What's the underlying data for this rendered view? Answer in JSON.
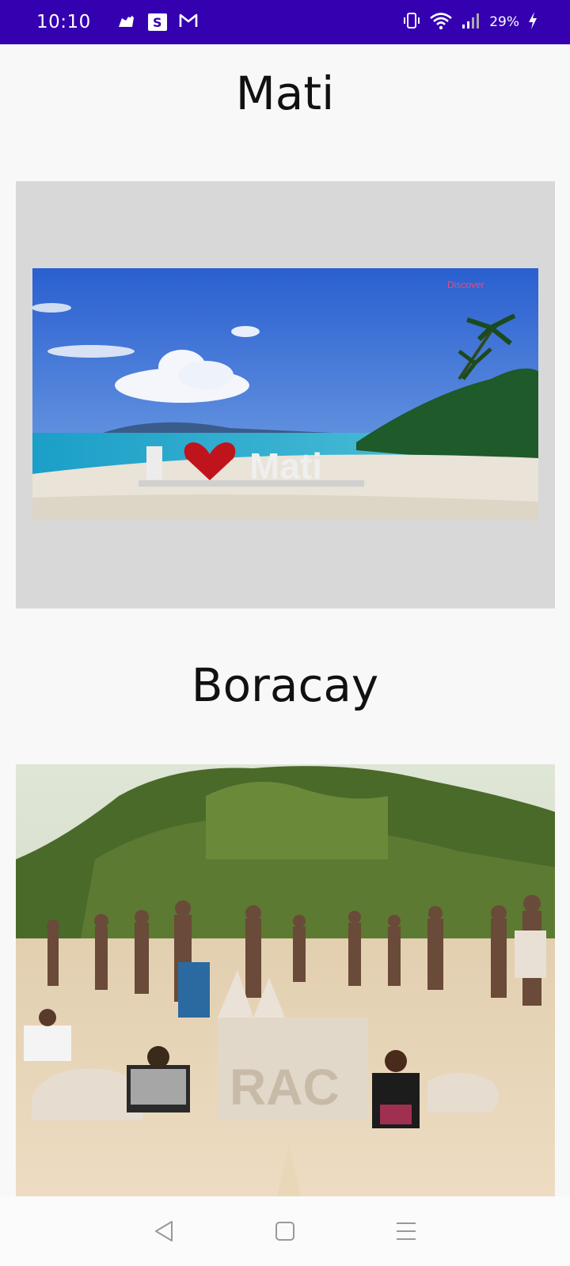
{
  "status_bar": {
    "time": "10:10",
    "battery": "29%",
    "left_icons": [
      "paw-icon",
      "s-app-icon",
      "gmail-icon"
    ],
    "right_icons": [
      "vibrate-icon",
      "wifi-icon",
      "signal-icon",
      "battery-charging-icon"
    ],
    "s_badge": "S",
    "background": "#3500b0"
  },
  "sections": [
    {
      "title": "Mati",
      "image": {
        "description_icon": "beach-photo",
        "sign_text": "I ♥ Mati",
        "watermark": "Discover"
      }
    },
    {
      "title": "Boracay",
      "image": {
        "description_icon": "beach-crowd-photo",
        "sand_sculpture_text": "I ♥ BORACAY"
      }
    }
  ],
  "nav_bar": {
    "buttons": [
      "back-icon",
      "home-icon",
      "recents-icon"
    ]
  }
}
